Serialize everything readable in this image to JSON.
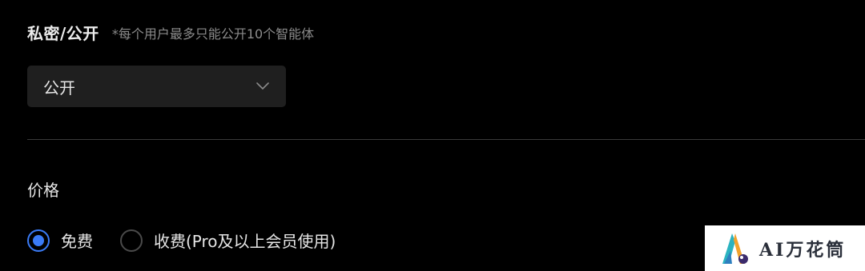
{
  "visibility": {
    "title": "私密/公开",
    "hint": "*每个用户最多只能公开10个智能体",
    "selected_value": "公开"
  },
  "price": {
    "title": "价格",
    "options": [
      {
        "label": "免费",
        "checked": true
      },
      {
        "label": "收费(Pro及以上会员使用)",
        "checked": false
      }
    ]
  },
  "watermark": {
    "text": "AI万花筒"
  },
  "colors": {
    "background": "#000000",
    "accent": "#3a7bf6",
    "select_bg": "#1f1f1f",
    "divider": "#3a3a3a"
  },
  "icons": {
    "select_chevron": "chevron-down-icon"
  }
}
